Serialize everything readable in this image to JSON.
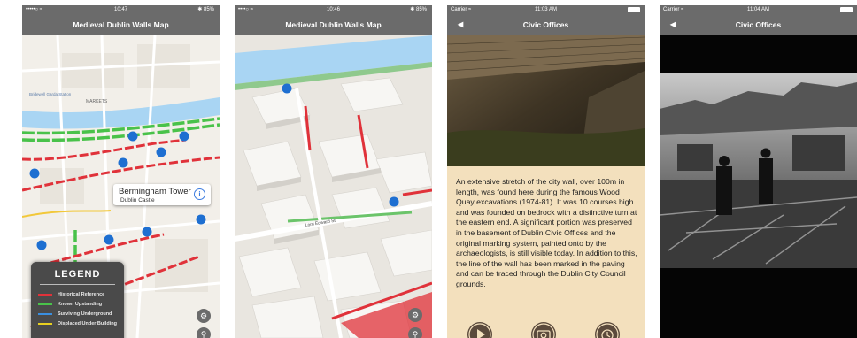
{
  "screens": [
    {
      "status": {
        "carrier": "•••••○ ≈",
        "time": "10:47",
        "battery": "✱ 85%"
      },
      "nav_title": "Medieval Dublin Walls Map",
      "map_labels": [
        "MARKETS",
        "Bridewell Garda Station",
        "Dublin Castle",
        "Dublin Castle"
      ],
      "callout": {
        "title": "Bermingham Tower",
        "subtitle": "Dublin Castle"
      },
      "legend": {
        "title": "LEGEND",
        "items": [
          {
            "label": "Historical Reference",
            "color": "#e0323a"
          },
          {
            "label": "Known Upstanding",
            "color": "#49c24a"
          },
          {
            "label": "Surviving Underground",
            "color": "#3a8fe0"
          },
          {
            "label": "Displaced Under Building",
            "color": "#e8d020"
          }
        ]
      }
    },
    {
      "status": {
        "carrier": "••••○ ≈",
        "time": "10:46",
        "battery": "✱ 85%"
      },
      "nav_title": "Medieval Dublin Walls Map",
      "map_labels": [
        "Lord Edward St"
      ]
    },
    {
      "status": {
        "carrier": "Carrier ≈",
        "time": "11:03 AM",
        "battery": ""
      },
      "nav_title": "Civic Offices",
      "back": "◀",
      "description": "An extensive stretch of the city wall, over 100m in length, was found here during the famous Wood Quay excavations (1974-81). It was 10 courses high and was founded on bedrock with a distinctive turn at the eastern end. A significant portion was preserved in the basement of Dublin Civic Offices and the original marking system, painted onto by the archaeologists, is still visible today. In addition to this, the line of the wall has been marked in the paving and can be traced through the Dublin City Council grounds."
    },
    {
      "status": {
        "carrier": "Carrier ≈",
        "time": "11:04 AM",
        "battery": ""
      },
      "nav_title": "Civic Offices",
      "back": "◀"
    }
  ],
  "colors": {
    "bar": "#6b6b6b",
    "panel": "#f3e0bd",
    "accent_pin": "#1e6fd1"
  }
}
